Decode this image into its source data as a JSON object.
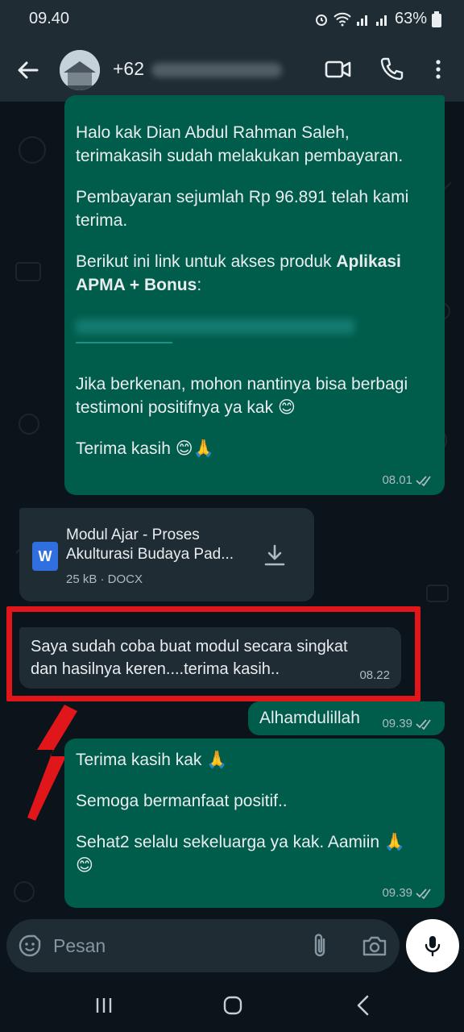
{
  "status_bar": {
    "time": "09.40",
    "battery": "63%"
  },
  "header": {
    "contact_prefix": "+62"
  },
  "messages": {
    "m1": {
      "line1": "Halo kak Dian Abdul Rahman Saleh,",
      "line2": "terimakasih sudah melakukan pembayaran.",
      "line3": "Pembayaran sejumlah Rp 96.891 telah kami",
      "line4": "terima.",
      "line5a": "Berikut ini link untuk akses produk ",
      "line5b": "Aplikasi",
      "line6": "APMA + Bonus",
      "line6b": ":",
      "line7": "Jika berkenan, mohon nantinya bisa berbagi",
      "line8": "testimoni positifnya ya kak 😊",
      "line9": "Terima kasih 😊🙏",
      "time": "08.01"
    },
    "doc": {
      "title_line1": "Modul Ajar - Proses",
      "title_line2": "Akulturasi Budaya Pad...",
      "info": "25 kB · DOCX",
      "icon_letter": "W"
    },
    "m2": {
      "line1": "Saya sudah coba buat modul secara singkat",
      "line2": "dan hasilnya keren....terima kasih..",
      "time": "08.22"
    },
    "m3": {
      "text": "Alhamdulillah",
      "time": "09.39"
    },
    "m4": {
      "line1": "Terima kasih kak 🙏",
      "line2": "Semoga bermanfaat positif..",
      "line3": "Sehat2 selalu sekeluarga ya kak. Aamiin 🙏",
      "line4": "😊",
      "time": "09.39"
    }
  },
  "composer": {
    "placeholder": "Pesan"
  },
  "colors": {
    "outgoing_bubble": "#005c4b",
    "incoming_bubble": "#1f2c34",
    "highlight": "#e0161b",
    "background": "#0b141a"
  }
}
